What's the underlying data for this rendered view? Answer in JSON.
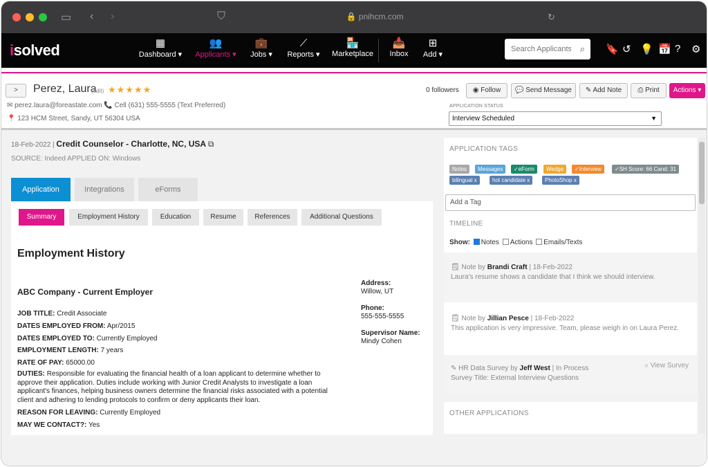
{
  "browser": {
    "url": "pnihcm.com"
  },
  "nav": {
    "logo_dot": "i",
    "logo_text": "solved",
    "items": [
      {
        "label": "Dashboard",
        "icon": "dashboard-icon"
      },
      {
        "label": "Applicants",
        "icon": "users-icon"
      },
      {
        "label": "Jobs",
        "icon": "briefcase-icon"
      },
      {
        "label": "Reports",
        "icon": "chart-line-icon"
      },
      {
        "label": "Marketplace",
        "icon": "store-icon"
      },
      {
        "label": "Inbox",
        "icon": "inbox-icon"
      },
      {
        "label": "Add",
        "icon": "plus-square-icon"
      }
    ],
    "search_placeholder": "Search Applicants"
  },
  "candidate": {
    "name": "Perez, Laura",
    "edit": "(edit)",
    "stars": 5,
    "email": "perez.laura@foreastate.com",
    "phone": "Cell (631) 555-5555 (Text Preferred)",
    "address": "123 HCM Street, Sandy, UT 56304 USA"
  },
  "header": {
    "followers": "0 followers",
    "follow": "Follow",
    "send_message": "Send Message",
    "add_note": "Add Note",
    "print": "Print",
    "actions": "Actions",
    "status_label": "APPLICATION STATUS",
    "status_value": "Interview Scheduled"
  },
  "job": {
    "date": "18-Feb-2022",
    "title": "Credit Counselor - Charlotte, NC, USA",
    "source": "SOURCE: Indeed APPLIED ON: Windows"
  },
  "tabs": [
    "Application",
    "Integrations",
    "eForms"
  ],
  "subtabs": [
    "Summary",
    "Employment History",
    "Education",
    "Resume",
    "References",
    "Additional Questions"
  ],
  "employment": {
    "section_title": "Employment History",
    "employer": "ABC Company - Current Employer",
    "job_title_label": "JOB TITLE:",
    "job_title": "Credit Associate",
    "from_label": "DATES EMPLOYED FROM:",
    "from": "Apr/2015",
    "to_label": "DATES EMPLOYED TO:",
    "to": "Currently Employed",
    "length_label": "EMPLOYMENT LENGTH:",
    "length": "7 years",
    "pay_label": "RATE OF PAY:",
    "pay": "65000.00",
    "duties_label": "DUTIES:",
    "duties": "Responsible for evaluating the financial health of a loan applicant to determine whether to approve their application. Duties include working with Junior Credit Analysts to investigate a loan applicant's finances, helping business owners determine the financial risks associated with a potential client and adhering to lending protocols to confirm or deny applicants their loan.",
    "reason_label": "REASON FOR LEAVING:",
    "reason": "Currently Employed",
    "contact_label": "MAY WE CONTACT?:",
    "contact": "Yes",
    "address_label": "Address:",
    "address": "Willow, UT",
    "phone_label": "Phone:",
    "phone": "555-555-5555",
    "supervisor_label": "Supervisor Name:",
    "supervisor": "Mindy Cohen"
  },
  "tags_panel": {
    "label": "APPLICATION TAGS",
    "tags_row1": [
      {
        "text": "Notes",
        "color": "#a8a8a8"
      },
      {
        "text": "Messages",
        "color": "#5aa4d9"
      },
      {
        "text": "✓eForm",
        "color": "#1b8a6b"
      },
      {
        "text": "Wedge",
        "color": "#f0a830"
      },
      {
        "text": "✓Interview",
        "color": "#f08a30"
      },
      {
        "text": "✓SH Score: 66 Cand: 31",
        "color": "#7f8c8d"
      }
    ],
    "tags_row2": [
      {
        "text": "bilingual",
        "color": "#5b7fb0"
      },
      {
        "text": "hot candidate",
        "color": "#5b7fb0"
      },
      {
        "text": "PhotoShop",
        "color": "#5b7fb0"
      }
    ],
    "remove_mark": "x",
    "add_tag_placeholder": "Add a Tag"
  },
  "timeline": {
    "label": "TIMELINE",
    "show_label": "Show:",
    "filter_notes": "Notes",
    "filter_actions": "Actions",
    "filter_emails": "Emails/Texts",
    "items": [
      {
        "prefix": "Note by",
        "author": "Brandi Craft",
        "date": "| 18-Feb-2022",
        "body": "Laura's resume shows a candidate that I think we should interview."
      },
      {
        "prefix": "Note by",
        "author": "Jillian Pesce",
        "date": "| 18-Feb-2022",
        "body": "This application is very impressive. Team, please weigh in on Laura Perez."
      },
      {
        "prefix": "HR Data Survey by",
        "author": "Jeff West",
        "date": "| In Process",
        "body": "Survey Title: External Interview Questions",
        "action": "View Survey"
      }
    ]
  },
  "other_applications": "OTHER APPLICATIONS",
  "colors": {
    "accent": "#e0168b",
    "tab_active": "#0d8fd3",
    "star": "#f5a623"
  }
}
